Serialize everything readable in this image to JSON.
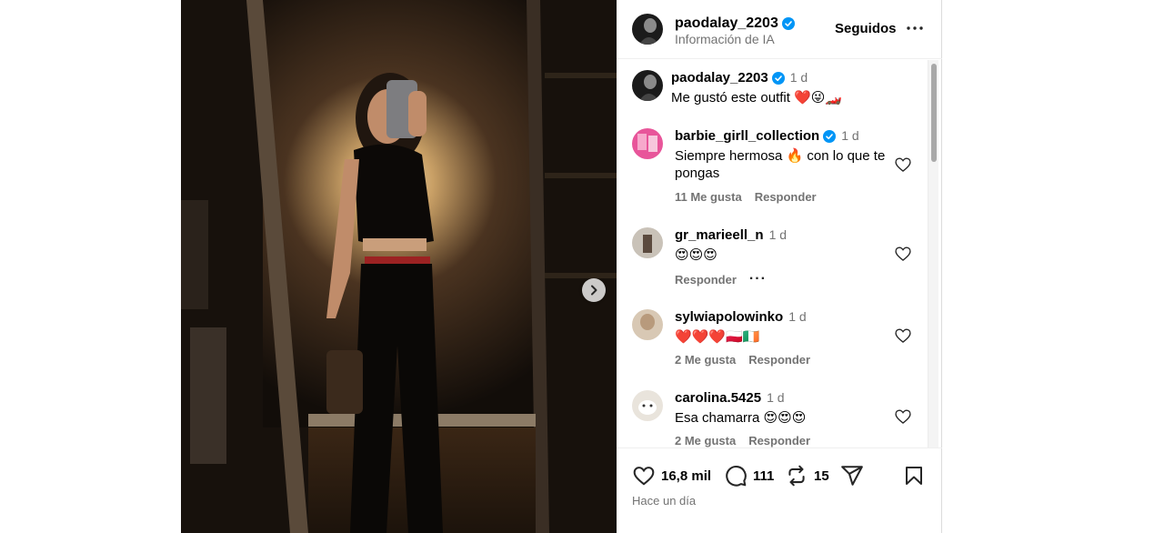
{
  "post": {
    "author": "paodalay_2203",
    "subtitle": "Información de IA",
    "follow_label": "Seguidos",
    "caption": {
      "user": "paodalay_2203",
      "time": "1 d",
      "text": "Me gustó este outfit ❤️😜🏎️"
    }
  },
  "comments": [
    {
      "user": "barbie_girll_collection",
      "verified": true,
      "time": "1 d",
      "text": "Siempre hermosa 🔥 con lo que te pongas",
      "likes": "11 Me gusta",
      "reply": "Responder"
    },
    {
      "user": "gr_marieell_n",
      "verified": false,
      "time": "1 d",
      "text": "😍😍😍",
      "likes": "",
      "reply": "Responder"
    },
    {
      "user": "sylwiapolowinko",
      "verified": false,
      "time": "1 d",
      "text": "❤️❤️❤️🇵🇱🇮🇪",
      "likes": "2 Me gusta",
      "reply": "Responder"
    },
    {
      "user": "carolina.5425",
      "verified": false,
      "time": "1 d",
      "text": "Esa chamarra 😍😍😍",
      "likes": "2 Me gusta",
      "reply": "Responder"
    }
  ],
  "actions": {
    "likes": "16,8 mil",
    "comments": "111",
    "reposts": "15",
    "posted": "Hace un día"
  },
  "icons": {
    "verified": "verified-badge-icon",
    "more": "more-options-icon",
    "heart": "heart-icon",
    "comment": "comment-icon",
    "repost": "repost-icon",
    "share": "share-icon",
    "save": "bookmark-icon",
    "next": "chevron-right-icon"
  },
  "colors": {
    "verified": "#0095f6",
    "muted": "#737373",
    "border": "#dbdbdb"
  }
}
